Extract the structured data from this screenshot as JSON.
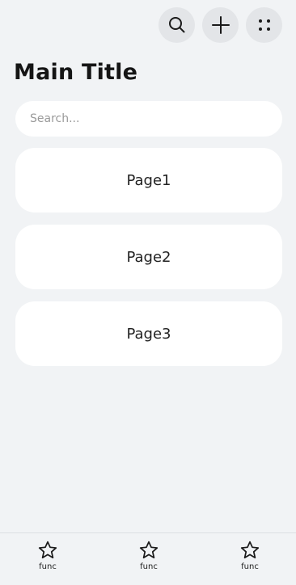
{
  "header": {
    "title": "Main Title",
    "actions": [
      {
        "icon": "search-icon"
      },
      {
        "icon": "plus-icon"
      },
      {
        "icon": "more-icon"
      }
    ]
  },
  "search": {
    "placeholder": "Search..."
  },
  "pages": [
    {
      "label": "Page1"
    },
    {
      "label": "Page2"
    },
    {
      "label": "Page3"
    }
  ],
  "tab_bar": {
    "items": [
      {
        "label": "func",
        "icon": "star-icon"
      },
      {
        "label": "func",
        "icon": "star-icon"
      },
      {
        "label": "func",
        "icon": "star-icon"
      }
    ]
  }
}
